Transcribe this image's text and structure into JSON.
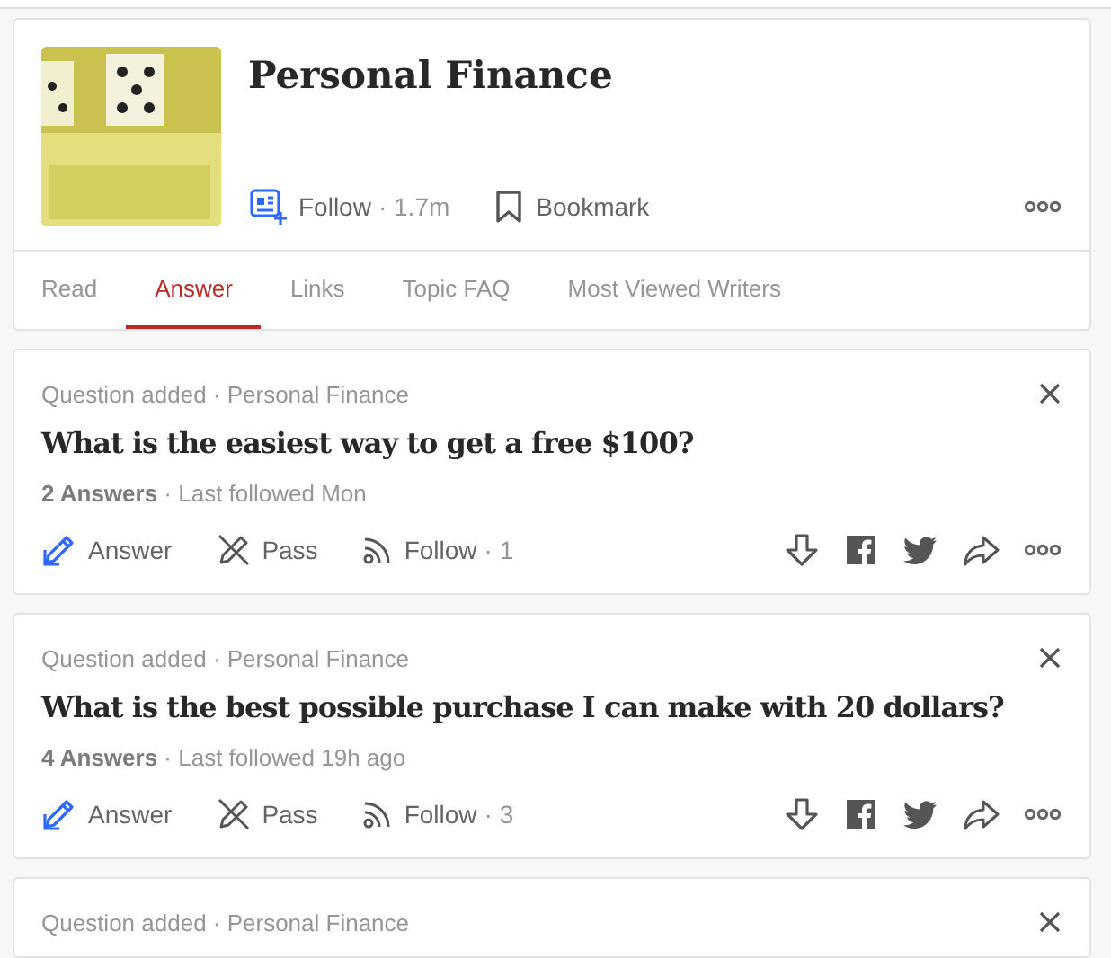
{
  "topic": {
    "kind": "picture",
    "title": "Personal Finance",
    "follow_label": "Follow",
    "follower_count": "· 1.7m",
    "bookmark_label": "Bookmark"
  },
  "tabs": [
    {
      "label": "Read",
      "selected": false
    },
    {
      "label": "Answer",
      "selected": true
    },
    {
      "label": "Links",
      "selected": false
    },
    {
      "label": "Topic FAQ",
      "selected": false
    },
    {
      "label": "Most Viewed Writers",
      "selected": false
    }
  ],
  "questions": [
    {
      "meta": "Question added · Personal Finance",
      "title": "What is the easiest way to get a free $100?",
      "stats": "**2 Answers** · Last followed Mon",
      "answer_label": "Answer",
      "pass_label": "Pass",
      "follow_label": "Follow",
      "follow_count": "· 1"
    },
    {
      "meta": "Question added · Personal Finance",
      "title": "What is the best possible purchase I can make with 20 dollars?",
      "stats": "**4 Answers** · Last followed 19h ago",
      "answer_label": "Answer",
      "pass_label": "Pass",
      "follow_label": "Follow",
      "follow_count": "· 3"
    },
    {
      "meta": "Question added · Personal Finance"
    }
  ]
}
